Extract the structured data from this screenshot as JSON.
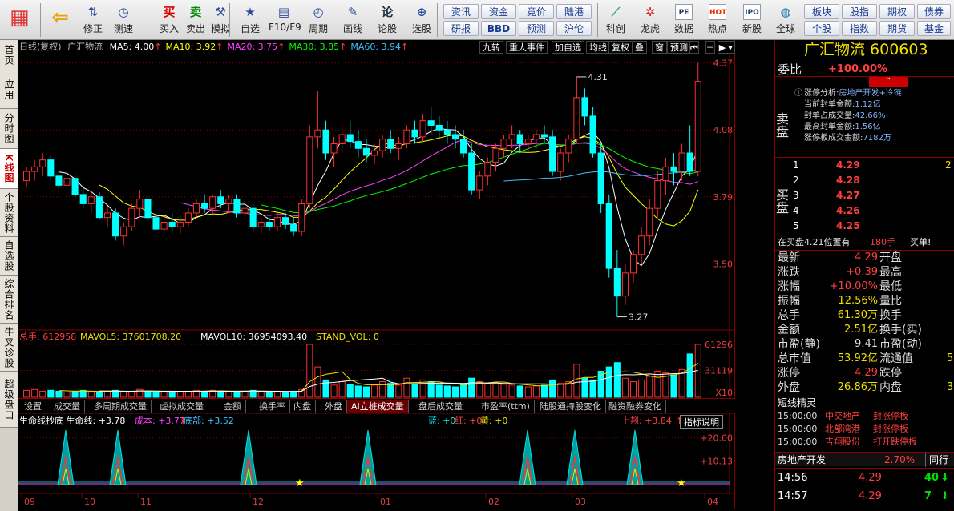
{
  "toolbar": {
    "main_buttons": [
      {
        "label": "",
        "icon": "windows-icon"
      },
      {
        "label": "",
        "icon": "back-arrow-icon"
      },
      {
        "label": "修正",
        "icon": "refresh-icon"
      },
      {
        "label": "测速",
        "icon": "clock-icon"
      },
      {
        "label": "买入",
        "icon": "buy-icon",
        "glyph": "买"
      },
      {
        "label": "卖出",
        "icon": "sell-icon",
        "glyph": "卖"
      },
      {
        "label": "模拟",
        "icon": "hammer-icon"
      },
      {
        "label": "自选",
        "icon": "star-icon"
      },
      {
        "label": "F10/F9",
        "icon": "f10-icon"
      },
      {
        "label": "周期",
        "icon": "period-icon"
      },
      {
        "label": "画线",
        "icon": "pencil-icon"
      },
      {
        "label": "论股",
        "icon": "discuss-icon",
        "glyph": "论"
      },
      {
        "label": "选股",
        "icon": "pick-icon"
      }
    ],
    "grid_buttons": [
      "资讯",
      "资金",
      "竞价",
      "陆港",
      "研报",
      "BBD",
      "预测",
      "沪伦"
    ],
    "icon_buttons": [
      {
        "label": "科创",
        "icon": "chart-icon"
      },
      {
        "label": "龙虎",
        "icon": "dragon-icon"
      },
      {
        "label": "数据",
        "icon": "pe-icon",
        "glyph": "PE"
      },
      {
        "label": "热点",
        "icon": "hot-icon",
        "glyph": "HOT"
      },
      {
        "label": "新股",
        "icon": "ipo-icon",
        "glyph": "IPO"
      },
      {
        "label": "全球",
        "icon": "globe-icon"
      }
    ],
    "right_grid": [
      "板块",
      "股指",
      "期权",
      "债券",
      "个股",
      "指数",
      "期货",
      "基金"
    ]
  },
  "left_tabs": [
    "首页",
    "应用",
    "分时图",
    "K线图",
    "个股资料",
    "自选股",
    "综合排名",
    "牛叉诊股",
    "超级盘口"
  ],
  "active_left_tab": "K线图",
  "chart_header": {
    "mode": "日线(复权)",
    "stock": "广汇物流",
    "ma": [
      {
        "label": "MA5: 4.00",
        "color": "#ffffff"
      },
      {
        "label": "MA10: 3.92",
        "color": "#ffff00"
      },
      {
        "label": "MA20: 3.75",
        "color": "#ff40ff"
      },
      {
        "label": "MA30: 3.85",
        "color": "#00ff00"
      },
      {
        "label": "MA60: 3.94",
        "color": "#40c0ff"
      }
    ],
    "controls": [
      "九转",
      "重大事件",
      "加自选",
      "均线",
      "复权",
      "叠",
      "窗",
      "预测",
      "⏮",
      "⊣",
      "▶",
      "▾"
    ]
  },
  "price_axis": [
    "4.37",
    "4.08",
    "3.79",
    "3.50"
  ],
  "price_marks": {
    "high": "4.31",
    "low": "3.27"
  },
  "volume_header": {
    "items": [
      {
        "text": "总手: 612958",
        "color": "#ff4040"
      },
      {
        "text": "MAVOL5: 37601708.20",
        "color": "#f0e000"
      },
      {
        "text": "MAVOL10: 36954093.40",
        "color": "#ffffff"
      },
      {
        "text": "STAND_VOL: 0",
        "color": "#f0e000"
      }
    ],
    "axis": [
      "61296",
      "31119",
      "X10"
    ]
  },
  "bottom_tabs": [
    "设置",
    "成交量",
    "多周期成交量",
    "虚拟成交量",
    "金额",
    "换手率",
    "内盘",
    "外盘",
    "AI立桩成交量",
    "盘后成交量",
    "市盈率(ttm)",
    "陆股通持股变化",
    "融资融券变化"
  ],
  "active_bottom_tab": "AI立桩成交量",
  "indicator": {
    "items": [
      {
        "text": "生命线抄底 生命线: +3.78",
        "color": "#ffffff"
      },
      {
        "text": "成本: +3.77",
        "color": "#ff40ff"
      },
      {
        "text": "底部: +3.52",
        "color": "#40c0ff"
      },
      {
        "text": "蓝: +0",
        "color": "#00e0e0"
      },
      {
        "text": "红: +0",
        "color": "#ff4040"
      },
      {
        "text": "黄: +0",
        "color": "#f0e000"
      },
      {
        "text": "上翘: +3.84",
        "color": "#ff4040"
      }
    ],
    "help": "指标说明",
    "axis": [
      "+20.00",
      "+10.13"
    ]
  },
  "dates": [
    "09",
    "10",
    "11",
    "12",
    "01",
    "02",
    "03",
    "04"
  ],
  "chart_data": {
    "type": "candlestick",
    "title": "广汇物流 600603 日线(复权)",
    "ylim": [
      3.2,
      4.4
    ],
    "note": "approximate daily OHLC read from chart",
    "candles": [
      [
        3.86,
        3.92,
        3.83,
        3.9
      ],
      [
        3.9,
        3.95,
        3.86,
        3.92
      ],
      [
        3.92,
        3.98,
        3.88,
        3.95
      ],
      [
        3.95,
        3.97,
        3.86,
        3.88
      ],
      [
        3.88,
        3.91,
        3.8,
        3.84
      ],
      [
        3.84,
        3.9,
        3.79,
        3.87
      ],
      [
        3.87,
        3.89,
        3.78,
        3.8
      ],
      [
        3.8,
        3.84,
        3.74,
        3.76
      ],
      [
        3.76,
        3.82,
        3.72,
        3.79
      ],
      [
        3.79,
        3.81,
        3.69,
        3.7
      ],
      [
        3.7,
        3.75,
        3.66,
        3.72
      ],
      [
        3.72,
        3.74,
        3.6,
        3.62
      ],
      [
        3.62,
        3.68,
        3.58,
        3.66
      ],
      [
        3.66,
        3.76,
        3.64,
        3.74
      ],
      [
        3.74,
        3.82,
        3.7,
        3.78
      ],
      [
        3.78,
        3.8,
        3.68,
        3.7
      ],
      [
        3.7,
        3.72,
        3.63,
        3.65
      ],
      [
        3.65,
        3.7,
        3.62,
        3.68
      ],
      [
        3.68,
        3.72,
        3.64,
        3.66
      ],
      [
        3.66,
        3.7,
        3.63,
        3.68
      ],
      [
        3.68,
        3.74,
        3.66,
        3.72
      ],
      [
        3.72,
        3.78,
        3.7,
        3.76
      ],
      [
        3.76,
        3.8,
        3.72,
        3.74
      ],
      [
        3.74,
        3.8,
        3.72,
        3.79
      ],
      [
        3.79,
        3.82,
        3.74,
        3.76
      ],
      [
        3.76,
        3.8,
        3.72,
        3.78
      ],
      [
        3.78,
        3.8,
        3.7,
        3.72
      ],
      [
        3.72,
        3.76,
        3.68,
        3.74
      ],
      [
        3.74,
        3.76,
        3.64,
        3.66
      ],
      [
        3.66,
        3.7,
        3.63,
        3.68
      ],
      [
        3.68,
        3.7,
        3.64,
        3.66
      ],
      [
        3.66,
        3.72,
        3.64,
        3.7
      ],
      [
        3.7,
        3.72,
        3.65,
        3.67
      ],
      [
        3.67,
        3.7,
        3.62,
        3.64
      ],
      [
        3.64,
        3.78,
        3.62,
        3.76
      ],
      [
        3.76,
        4.1,
        3.74,
        4.05
      ],
      [
        4.05,
        4.25,
        4.0,
        4.08
      ],
      [
        4.08,
        4.12,
        3.95,
        3.98
      ],
      [
        3.98,
        4.05,
        3.92,
        4.02
      ],
      [
        4.02,
        4.1,
        3.98,
        4.06
      ],
      [
        4.06,
        4.12,
        4.0,
        4.03
      ],
      [
        4.03,
        4.08,
        3.96,
        4.0
      ],
      [
        4.0,
        4.04,
        3.94,
        3.97
      ],
      [
        3.97,
        4.02,
        3.93,
        3.99
      ],
      [
        3.99,
        4.06,
        3.96,
        4.04
      ],
      [
        4.04,
        4.08,
        3.98,
        4.0
      ],
      [
        4.0,
        4.05,
        3.95,
        4.02
      ],
      [
        4.02,
        4.1,
        4.0,
        4.08
      ],
      [
        4.08,
        4.12,
        4.02,
        4.05
      ],
      [
        4.05,
        4.15,
        4.03,
        4.12
      ],
      [
        4.12,
        4.18,
        4.06,
        4.1
      ],
      [
        4.1,
        4.14,
        4.04,
        4.08
      ],
      [
        4.08,
        4.12,
        4.02,
        4.06
      ],
      [
        4.06,
        4.1,
        4.0,
        4.04
      ],
      [
        4.04,
        4.08,
        3.96,
        3.98
      ],
      [
        3.98,
        4.02,
        3.8,
        3.82
      ],
      [
        3.82,
        3.9,
        3.78,
        3.88
      ],
      [
        3.88,
        3.96,
        3.84,
        3.94
      ],
      [
        3.94,
        4.02,
        3.9,
        4.0
      ],
      [
        4.0,
        4.06,
        3.96,
        4.04
      ],
      [
        4.04,
        4.1,
        4.0,
        4.06
      ],
      [
        4.06,
        4.08,
        3.98,
        4.02
      ],
      [
        4.02,
        4.06,
        3.98,
        4.04
      ],
      [
        4.04,
        4.08,
        4.0,
        4.06
      ],
      [
        4.06,
        4.1,
        4.02,
        4.05
      ],
      [
        4.05,
        4.08,
        3.88,
        3.9
      ],
      [
        3.9,
        4.0,
        3.86,
        3.98
      ],
      [
        3.98,
        4.06,
        3.94,
        4.04
      ],
      [
        4.04,
        4.31,
        4.02,
        4.22
      ],
      [
        4.22,
        4.26,
        4.1,
        4.14
      ],
      [
        4.14,
        4.18,
        3.96,
        3.98
      ],
      [
        3.98,
        4.02,
        3.72,
        3.76
      ],
      [
        3.76,
        3.8,
        3.44,
        3.48
      ],
      [
        3.48,
        3.56,
        3.27,
        3.36
      ],
      [
        3.36,
        3.5,
        3.32,
        3.46
      ],
      [
        3.46,
        3.56,
        3.42,
        3.54
      ],
      [
        3.54,
        3.66,
        3.5,
        3.62
      ],
      [
        3.62,
        3.78,
        3.58,
        3.74
      ],
      [
        3.74,
        3.9,
        3.7,
        3.86
      ],
      [
        3.86,
        3.96,
        3.8,
        3.92
      ],
      [
        3.92,
        3.98,
        3.84,
        3.9
      ],
      [
        3.9,
        4.02,
        3.86,
        3.98
      ],
      [
        3.98,
        4.1,
        3.88,
        3.9
      ],
      [
        3.9,
        4.37,
        3.88,
        4.29
      ]
    ],
    "volume": [
      8,
      9,
      7,
      8,
      7,
      6,
      7,
      8,
      7,
      6,
      7,
      8,
      6,
      7,
      9,
      7,
      6,
      6,
      7,
      6,
      7,
      8,
      7,
      8,
      7,
      6,
      7,
      7,
      8,
      6,
      6,
      7,
      6,
      7,
      9,
      61,
      35,
      20,
      14,
      18,
      15,
      13,
      12,
      14,
      18,
      16,
      14,
      22,
      15,
      20,
      18,
      14,
      13,
      12,
      15,
      22,
      18,
      16,
      17,
      15,
      14,
      13,
      12,
      13,
      14,
      20,
      16,
      18,
      38,
      22,
      20,
      30,
      35,
      40,
      22,
      18,
      20,
      24,
      30,
      28,
      26,
      32,
      50,
      61
    ],
    "ma_series": [
      {
        "name": "MA5",
        "color": "#ffffff"
      },
      {
        "name": "MA10",
        "color": "#ffff00"
      },
      {
        "name": "MA20",
        "color": "#ff40ff"
      },
      {
        "name": "MA30",
        "color": "#00ff00"
      },
      {
        "name": "MA60",
        "color": "#40c0ff"
      }
    ]
  },
  "right_panel": {
    "title": "广汇物流 600603",
    "weibi_label": "委比",
    "weibi_value": "+100.00%",
    "limit_info": [
      {
        "label": "涨停分析:",
        "value": "房地产开发+冷链"
      },
      {
        "label": "当前封单金额:",
        "value": "1.12亿"
      },
      {
        "label": "封单占成交量:",
        "value": "42.66%"
      },
      {
        "label": "最高封单金额:",
        "value": "1.56亿"
      },
      {
        "label": "涨停板成交金额:",
        "value": "7182万"
      }
    ],
    "sell_label": "卖盘",
    "buy_label": "买盘",
    "bids": [
      {
        "level": "1",
        "price": "4.29",
        "vol": "2"
      },
      {
        "level": "2",
        "price": "4.28",
        "vol": ""
      },
      {
        "level": "3",
        "price": "4.27",
        "vol": ""
      },
      {
        "level": "4",
        "price": "4.26",
        "vol": ""
      },
      {
        "level": "5",
        "price": "4.25",
        "vol": ""
      }
    ],
    "position_line": {
      "text": "在买盘4.21位置有",
      "vol": "180手",
      "action": "买单!"
    },
    "stats": [
      {
        "l": "最新",
        "v": "4.29",
        "l2": "开盘",
        "v2": ""
      },
      {
        "l": "涨跌",
        "v": "+0.39",
        "l2": "最高",
        "v2": ""
      },
      {
        "l": "涨幅",
        "v": "+10.00%",
        "l2": "最低",
        "v2": ""
      },
      {
        "l": "振幅",
        "v": "12.56%",
        "l2": "量比",
        "v2": ""
      },
      {
        "l": "总手",
        "v": "61.30万",
        "l2": "换手",
        "v2": ""
      },
      {
        "l": "金额",
        "v": "2.51亿",
        "l2": "换手(实)",
        "v2": ""
      },
      {
        "l": "市盈(静)",
        "v": "9.41",
        "l2": "市盈(动)",
        "v2": ""
      },
      {
        "l": "总市值",
        "v": "53.92亿",
        "l2": "流通值",
        "v2": "5"
      },
      {
        "l": "涨停",
        "v": "4.29",
        "l2": "跌停",
        "v2": ""
      },
      {
        "l": "外盘",
        "v": "26.86万",
        "l2": "内盘",
        "v2": "3"
      }
    ],
    "short_title": "短线精灵",
    "short_items": [
      {
        "time": "15:00:00",
        "name": "中交地产",
        "event": "封涨停板"
      },
      {
        "time": "15:00:00",
        "name": "北部湾港",
        "event": "封涨停板"
      },
      {
        "time": "15:00:00",
        "name": "吉翔股份",
        "event": "打开跌停板"
      }
    ],
    "sector": {
      "name": "房地产开发",
      "change": "2.70%",
      "tab": "同行"
    },
    "ticks": [
      {
        "time": "14:56",
        "price": "4.29",
        "vol": "40"
      },
      {
        "time": "14:57",
        "price": "4.29",
        "vol": "7"
      }
    ]
  }
}
